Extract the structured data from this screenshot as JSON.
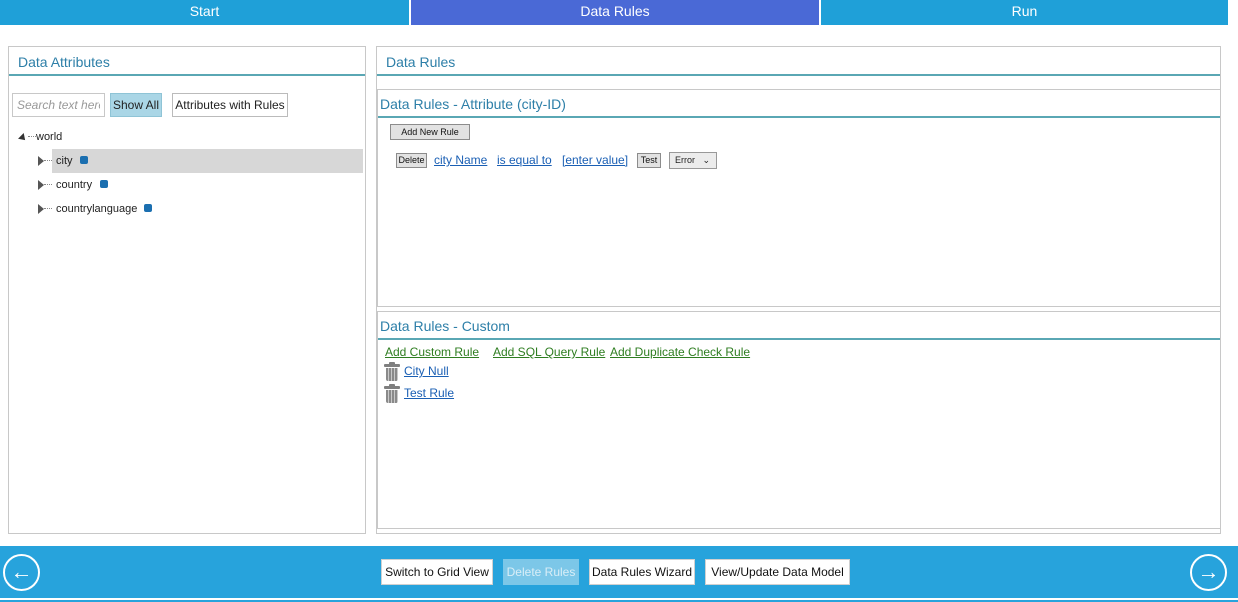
{
  "tabs": [
    {
      "label": "Start"
    },
    {
      "label": "Data Rules"
    },
    {
      "label": "Run"
    }
  ],
  "left_panel": {
    "title": "Data Attributes",
    "search_placeholder": "Search text here",
    "show_all_label": "Show All",
    "attributes_with_rules_label": "Attributes with Rules",
    "tree": {
      "root": "world",
      "children": [
        "city",
        "country",
        "countrylanguage"
      ]
    }
  },
  "right_panel": {
    "title": "Data Rules",
    "attribute_rules": {
      "title": "Data Rules - Attribute (city-ID)",
      "add_rule_label": "Add New Rule",
      "rule": {
        "delete_label": "Delete",
        "field": "city Name",
        "operator": "is equal to",
        "value": "[enter value]",
        "test_label": "Test",
        "severity": "Error"
      }
    },
    "custom_rules": {
      "title": "Data Rules - Custom",
      "add_custom_label": "Add Custom Rule",
      "add_sql_label": "Add SQL Query Rule",
      "add_duplicate_label": "Add Duplicate Check Rule",
      "items": [
        "City Null",
        "Test Rule"
      ]
    }
  },
  "bottom_bar": {
    "switch_grid_label": "Switch to Grid View",
    "delete_rules_label": "Delete Rules",
    "wizard_label": "Data Rules Wizard",
    "data_model_label": "View/Update Data Model",
    "back_icon": "←",
    "next_icon": "→"
  }
}
